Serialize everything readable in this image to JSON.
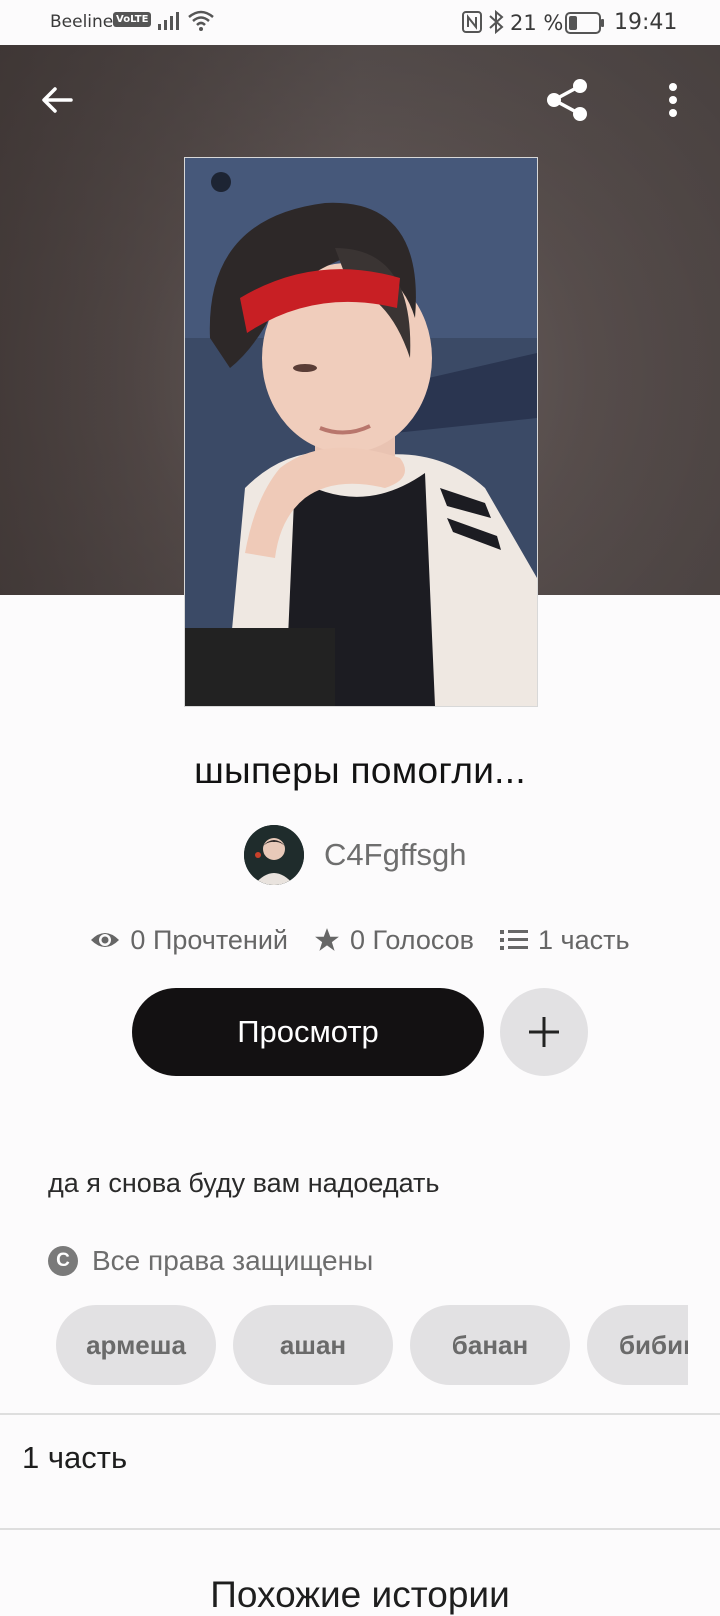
{
  "status_bar": {
    "carrier": "Beeline",
    "volte": "VoLTE",
    "battery_percent": "21 %",
    "time": "19:41",
    "icons": [
      "signal-icon",
      "wifi-icon",
      "nfc-icon",
      "bluetooth-icon",
      "battery-icon"
    ]
  },
  "toolbar": {
    "back_icon": "arrow-left-icon",
    "share_icon": "share-icon",
    "more_icon": "more-vertical-icon"
  },
  "story": {
    "title": "шыперы помогли...",
    "author": "C4Fgffsgh",
    "stats": {
      "reads": "0 Прочтений",
      "votes": "0 Голосов",
      "parts": "1 часть"
    },
    "read_button": "Просмотр",
    "description": "да я снова буду вам надоедать",
    "copyright": "Все права защищены",
    "tags": [
      "армеша",
      "ашан",
      "банан",
      "бибиш"
    ]
  },
  "sections": {
    "parts_count": "1 часть",
    "similar": "Похожие истории"
  },
  "colors": {
    "primary_button": "#131112",
    "secondary_button": "#e2e1e3",
    "background": "#fcfbfc"
  }
}
